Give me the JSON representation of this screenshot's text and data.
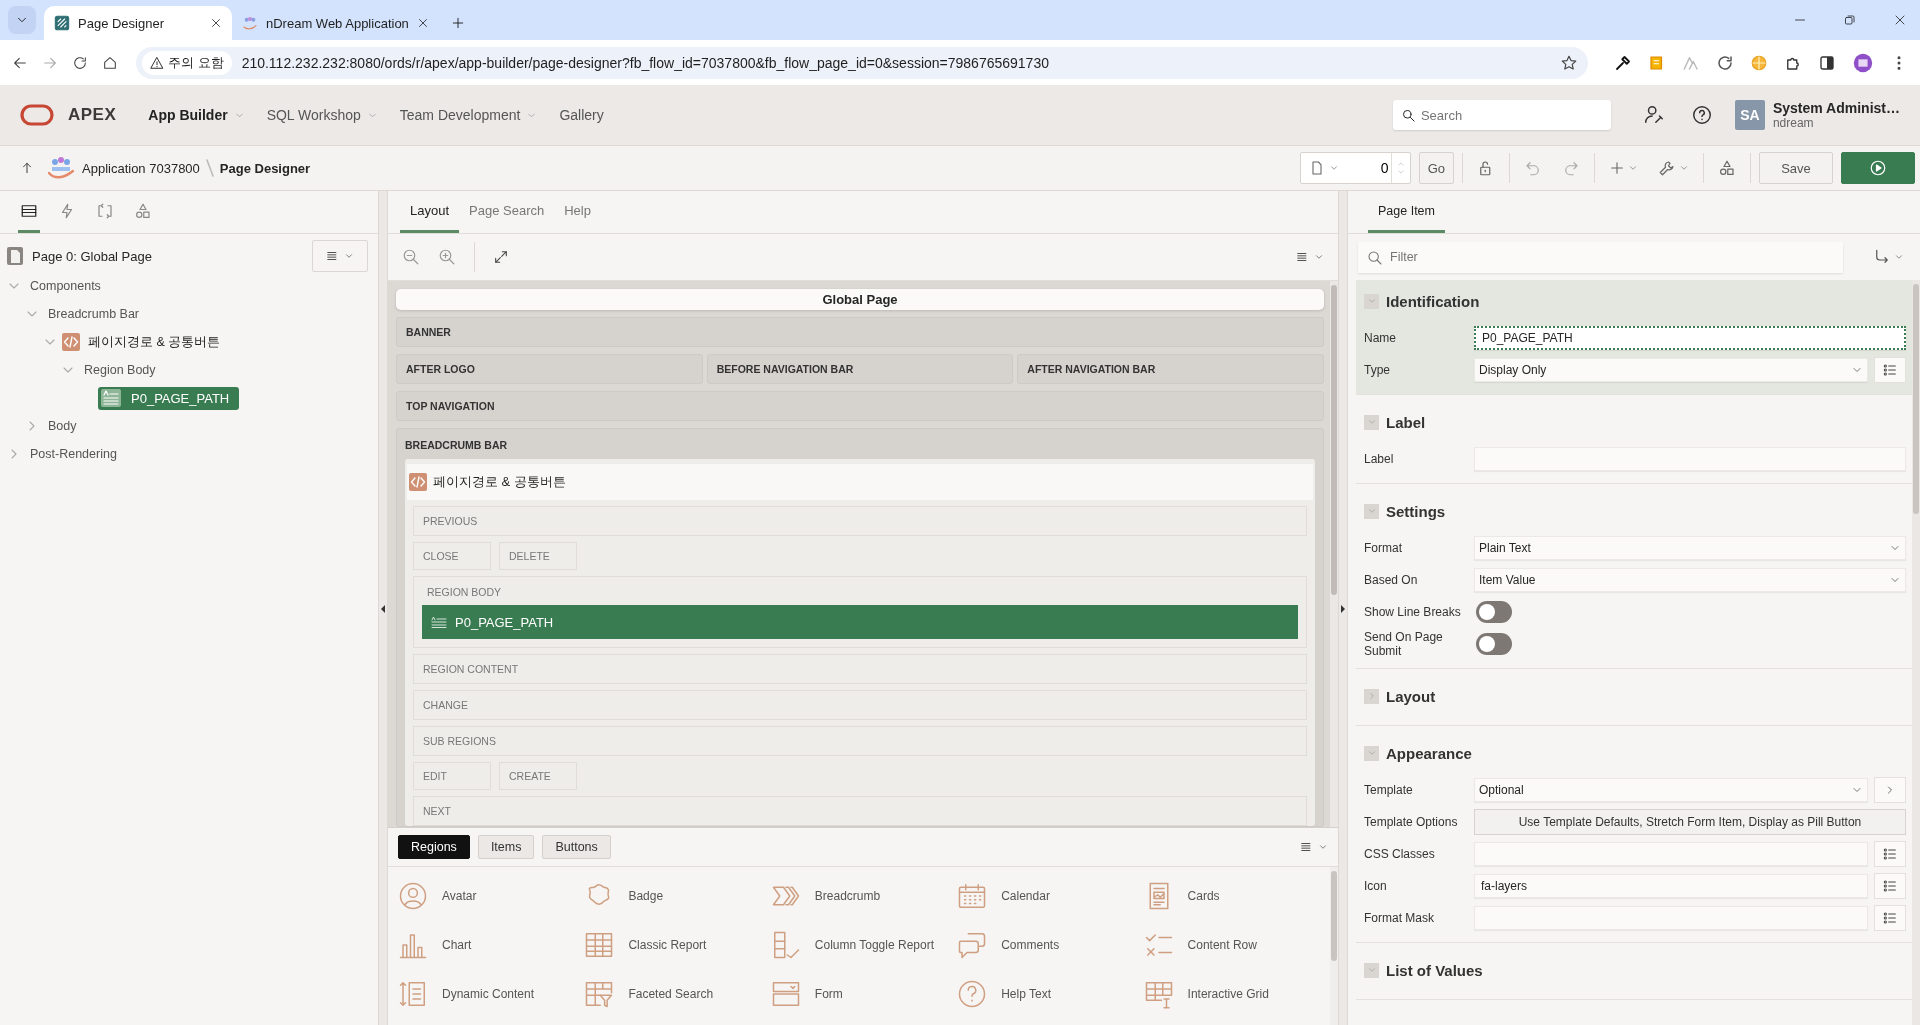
{
  "browser": {
    "tabs": [
      {
        "title": "Page Designer",
        "selected": true
      },
      {
        "title": "nDream Web Application",
        "selected": false
      }
    ],
    "address": {
      "warning": "주의 요함",
      "url": "210.112.232.232:8080/ords/r/apex/app-builder/page-designer?fb_flow_id=7037800&fb_flow_page_id=0&session=7986765691730"
    }
  },
  "header": {
    "logo": "APEX",
    "nav": [
      {
        "label": "App Builder",
        "selected": true,
        "menu": true
      },
      {
        "label": "SQL Workshop",
        "selected": false,
        "menu": true
      },
      {
        "label": "Team Development",
        "selected": false,
        "menu": true
      },
      {
        "label": "Gallery",
        "selected": false,
        "menu": false
      }
    ],
    "search": {
      "placeholder": "Search"
    },
    "user": {
      "initials": "SA",
      "name": "System Administ…",
      "workspace": "ndream"
    }
  },
  "toolbar": {
    "breadcrumb": [
      "Application 7037800",
      "Page Designer"
    ],
    "page_number": "0",
    "go": "Go",
    "save": "Save"
  },
  "left": {
    "tabs": [
      {
        "kind": "rendering",
        "selected": true
      },
      {
        "kind": "dynamic",
        "selected": false
      },
      {
        "kind": "processing",
        "selected": false
      },
      {
        "kind": "shared",
        "selected": false
      }
    ],
    "page_title": "Page 0: Global Page",
    "tree": [
      {
        "label": "Components",
        "kind": "folder",
        "expanded": true,
        "selected": false,
        "children": [
          {
            "label": "Breadcrumb Bar",
            "kind": "folder",
            "expanded": true,
            "selected": false,
            "children": [
              {
                "label": "페이지경로 & 공통버튼",
                "kind": "region",
                "expanded": true,
                "selected": false,
                "children": [
                  {
                    "label": "Region Body",
                    "kind": "folder",
                    "expanded": true,
                    "selected": false,
                    "children": [
                      {
                        "label": "P0_PAGE_PATH",
                        "kind": "item",
                        "selected": true
                      }
                    ]
                  }
                ]
              }
            ]
          },
          {
            "label": "Body",
            "kind": "folder",
            "expanded": false,
            "selected": false
          }
        ]
      },
      {
        "label": "Post-Rendering",
        "kind": "folder",
        "expanded": false,
        "selected": false
      }
    ]
  },
  "middle": {
    "tabs": [
      {
        "label": "Layout",
        "selected": true
      },
      {
        "label": "Page Search",
        "selected": false
      },
      {
        "label": "Help",
        "selected": false
      }
    ],
    "canvas": {
      "title": "Global Page",
      "rows": [
        [
          {
            "label": "BANNER"
          }
        ],
        [
          {
            "label": "AFTER LOGO"
          },
          {
            "label": "BEFORE NAVIGATION BAR"
          },
          {
            "label": "AFTER NAVIGATION BAR"
          }
        ],
        [
          {
            "label": "TOP NAVIGATION"
          }
        ]
      ],
      "breadcrumb_bar": {
        "label": "BREADCRUMB BAR",
        "region": {
          "title": "페이지경로 & 공통버튼",
          "slots": [
            {
              "kind": "position",
              "label": "PREVIOUS"
            },
            {
              "kind": "buttons",
              "labels": [
                "CLOSE",
                "DELETE"
              ]
            },
            {
              "kind": "body",
              "label": "REGION BODY",
              "items": [
                {
                  "label": "P0_PAGE_PATH",
                  "selected": true
                }
              ]
            },
            {
              "kind": "position",
              "label": "REGION CONTENT"
            },
            {
              "kind": "position",
              "label": "CHANGE"
            },
            {
              "kind": "position",
              "label": "SUB REGIONS"
            },
            {
              "kind": "buttons",
              "labels": [
                "EDIT",
                "CREATE"
              ]
            },
            {
              "kind": "position",
              "label": "NEXT"
            }
          ]
        }
      }
    },
    "gallery": {
      "tabs": [
        {
          "label": "Regions",
          "selected": true
        },
        {
          "label": "Items",
          "selected": false
        },
        {
          "label": "Buttons",
          "selected": false
        }
      ],
      "items": [
        {
          "label": "Avatar",
          "kind": "avatar"
        },
        {
          "label": "Badge",
          "kind": "badge"
        },
        {
          "label": "Breadcrumb",
          "kind": "breadcrumb"
        },
        {
          "label": "Calendar",
          "kind": "calendar"
        },
        {
          "label": "Cards",
          "kind": "cards"
        },
        {
          "label": "Chart",
          "kind": "chart"
        },
        {
          "label": "Classic Report",
          "kind": "table"
        },
        {
          "label": "Column Toggle Report",
          "kind": "columns"
        },
        {
          "label": "Comments",
          "kind": "comments"
        },
        {
          "label": "Content Row",
          "kind": "list"
        },
        {
          "label": "Dynamic Content",
          "kind": "document"
        },
        {
          "label": "Faceted Search",
          "kind": "filter"
        },
        {
          "label": "Form",
          "kind": "form"
        },
        {
          "label": "Help Text",
          "kind": "question"
        },
        {
          "label": "Interactive Grid",
          "kind": "grid"
        }
      ]
    }
  },
  "right": {
    "tab": "Page Item",
    "filter": {
      "placeholder": "Filter"
    },
    "groups": [
      {
        "title": "Identification",
        "expanded": true,
        "current": true,
        "properties": [
          {
            "label": "Name",
            "kind": "text",
            "value": "P0_PAGE_PATH",
            "focused": true
          },
          {
            "label": "Type",
            "kind": "select",
            "value": "Display Only",
            "button": {
              "kind": "list"
            }
          }
        ]
      },
      {
        "title": "Label",
        "expanded": true,
        "current": false,
        "properties": [
          {
            "label": "Label",
            "kind": "text",
            "focused": false
          }
        ]
      },
      {
        "title": "Settings",
        "expanded": true,
        "current": false,
        "properties": [
          {
            "label": "Format",
            "kind": "select",
            "value": "Plain Text"
          },
          {
            "label": "Based On",
            "kind": "select",
            "value": "Item Value"
          },
          {
            "label": "Show Line Breaks",
            "kind": "switch",
            "on": false
          },
          {
            "label": "Send On Page Submit",
            "kind": "switch",
            "on": false
          }
        ]
      },
      {
        "title": "Layout",
        "expanded": false,
        "current": false
      },
      {
        "title": "Appearance",
        "expanded": true,
        "current": false,
        "properties": [
          {
            "label": "Template",
            "kind": "select",
            "value": "Optional",
            "button": {
              "kind": "open"
            }
          },
          {
            "label": "Template Options",
            "kind": "button",
            "value": "Use Template Defaults, Stretch Form Item, Display as Pill Button"
          },
          {
            "label": "CSS Classes",
            "kind": "text",
            "button": {
              "kind": "list"
            },
            "focused": false
          },
          {
            "label": "Icon",
            "kind": "text",
            "value": "fa-layers",
            "button": {
              "kind": "list"
            },
            "focused": false
          },
          {
            "label": "Format Mask",
            "kind": "text",
            "button": {
              "kind": "list"
            },
            "focused": false
          }
        ]
      },
      {
        "title": "List of Values",
        "expanded": true,
        "current": false
      }
    ]
  }
}
